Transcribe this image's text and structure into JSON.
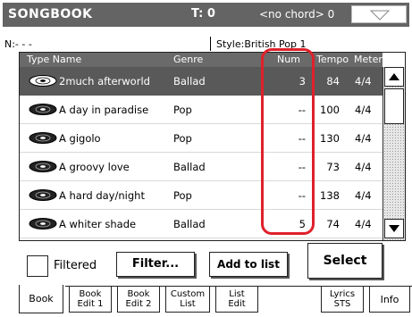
{
  "header": {
    "title": "SONGBOOK",
    "tempo": "T: 0",
    "chord": "<no chord>  0"
  },
  "info": {
    "lyrics_indicator": "N:- - -",
    "style": "Style:British Pop 1"
  },
  "table": {
    "columns": {
      "type_name": "Type  Name",
      "genre": "Genre",
      "num": "Num",
      "tempo": "Tempo",
      "meter": "Meter"
    },
    "rows": [
      {
        "name": "2much afterworld",
        "genre": "Ballad",
        "num": "3",
        "tempo": "84",
        "meter": "4/4"
      },
      {
        "name": "A day in paradise",
        "genre": "Pop",
        "num": "--",
        "tempo": "100",
        "meter": "4/4"
      },
      {
        "name": "A gigolo",
        "genre": "Pop",
        "num": "--",
        "tempo": "130",
        "meter": "4/4"
      },
      {
        "name": "A groovy love",
        "genre": "Ballad",
        "num": "--",
        "tempo": "73",
        "meter": "4/4"
      },
      {
        "name": "A hard day/night",
        "genre": "Pop",
        "num": "--",
        "tempo": "138",
        "meter": "4/4"
      },
      {
        "name": "A whiter shade",
        "genre": "Ballad",
        "num": "5",
        "tempo": "74",
        "meter": "4/4"
      }
    ]
  },
  "controls": {
    "filtered_label": "Filtered",
    "filter_button": "Filter...",
    "add_button": "Add to list",
    "select_button": "Select"
  },
  "tabs": [
    {
      "line1": "Book",
      "line2": ""
    },
    {
      "line1": "Book",
      "line2": "Edit 1"
    },
    {
      "line1": "Book",
      "line2": "Edit 2"
    },
    {
      "line1": "Custom",
      "line2": "List"
    },
    {
      "line1": "List",
      "line2": "Edit"
    },
    {
      "line1": "Lyrics",
      "line2": "STS"
    },
    {
      "line1": "Info",
      "line2": ""
    }
  ],
  "colors": {
    "header_bg": "#646464",
    "selected_row": "#595959",
    "highlight": "#e0202a"
  }
}
